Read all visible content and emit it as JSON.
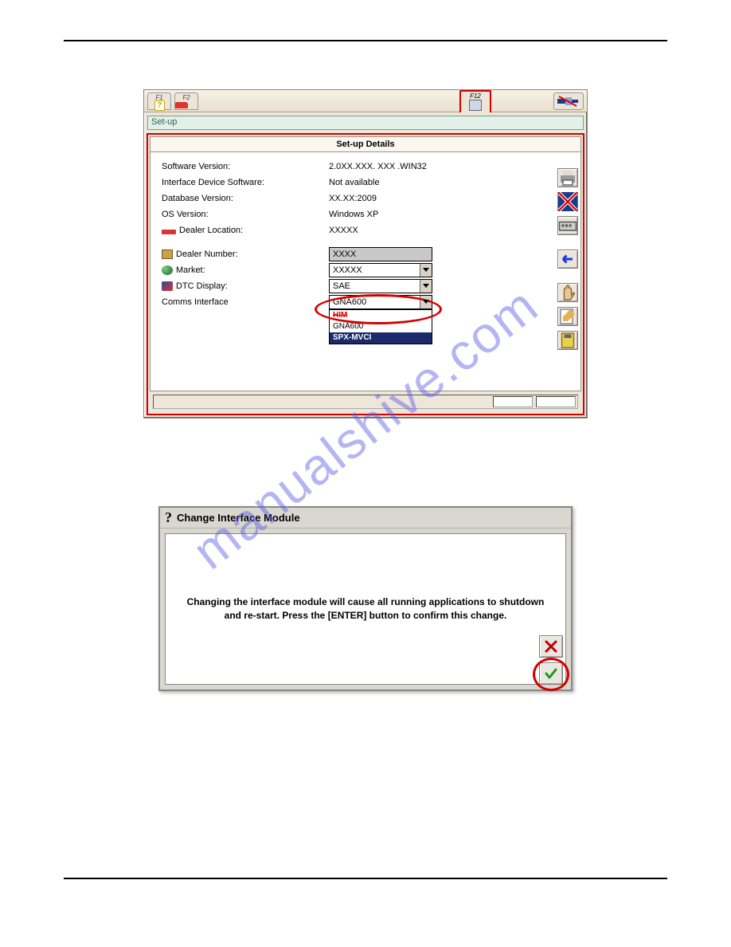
{
  "watermark": "manualshive.com",
  "app": {
    "tabs": {
      "f1": "F1",
      "f2": "F2",
      "f12": "F12"
    },
    "setup_label": "Set-up",
    "panel_title": "Set-up Details",
    "rows": {
      "software_version": {
        "label": "Software Version:",
        "value": "2.0XX.XXX. XXX .WIN32"
      },
      "interface_device": {
        "label": "Interface Device Software:",
        "value": "Not available"
      },
      "database_version": {
        "label": "Database Version:",
        "value": "XX.XX:2009"
      },
      "os_version": {
        "label": "OS Version:",
        "value": "Windows XP"
      },
      "dealer_location": {
        "label": "Dealer Location:",
        "value": "XXXXX"
      },
      "dealer_number": {
        "label": "Dealer Number:",
        "value": "XXXX"
      },
      "market": {
        "label": "Market:",
        "value": "XXXXX"
      },
      "dtc_display": {
        "label": "DTC Display:",
        "value": "SAE"
      },
      "comms_interface": {
        "label": "Comms Interface",
        "value": "GNA600"
      }
    },
    "comms_options": {
      "opt1": "HIM",
      "opt2": "GNA600",
      "opt3": "SPX-MVCI"
    }
  },
  "dialog": {
    "title": "Change Interface Module",
    "message": "Changing the interface module will cause all running applications to shutdown and re-start. Press the [ENTER] button to confirm this change."
  }
}
